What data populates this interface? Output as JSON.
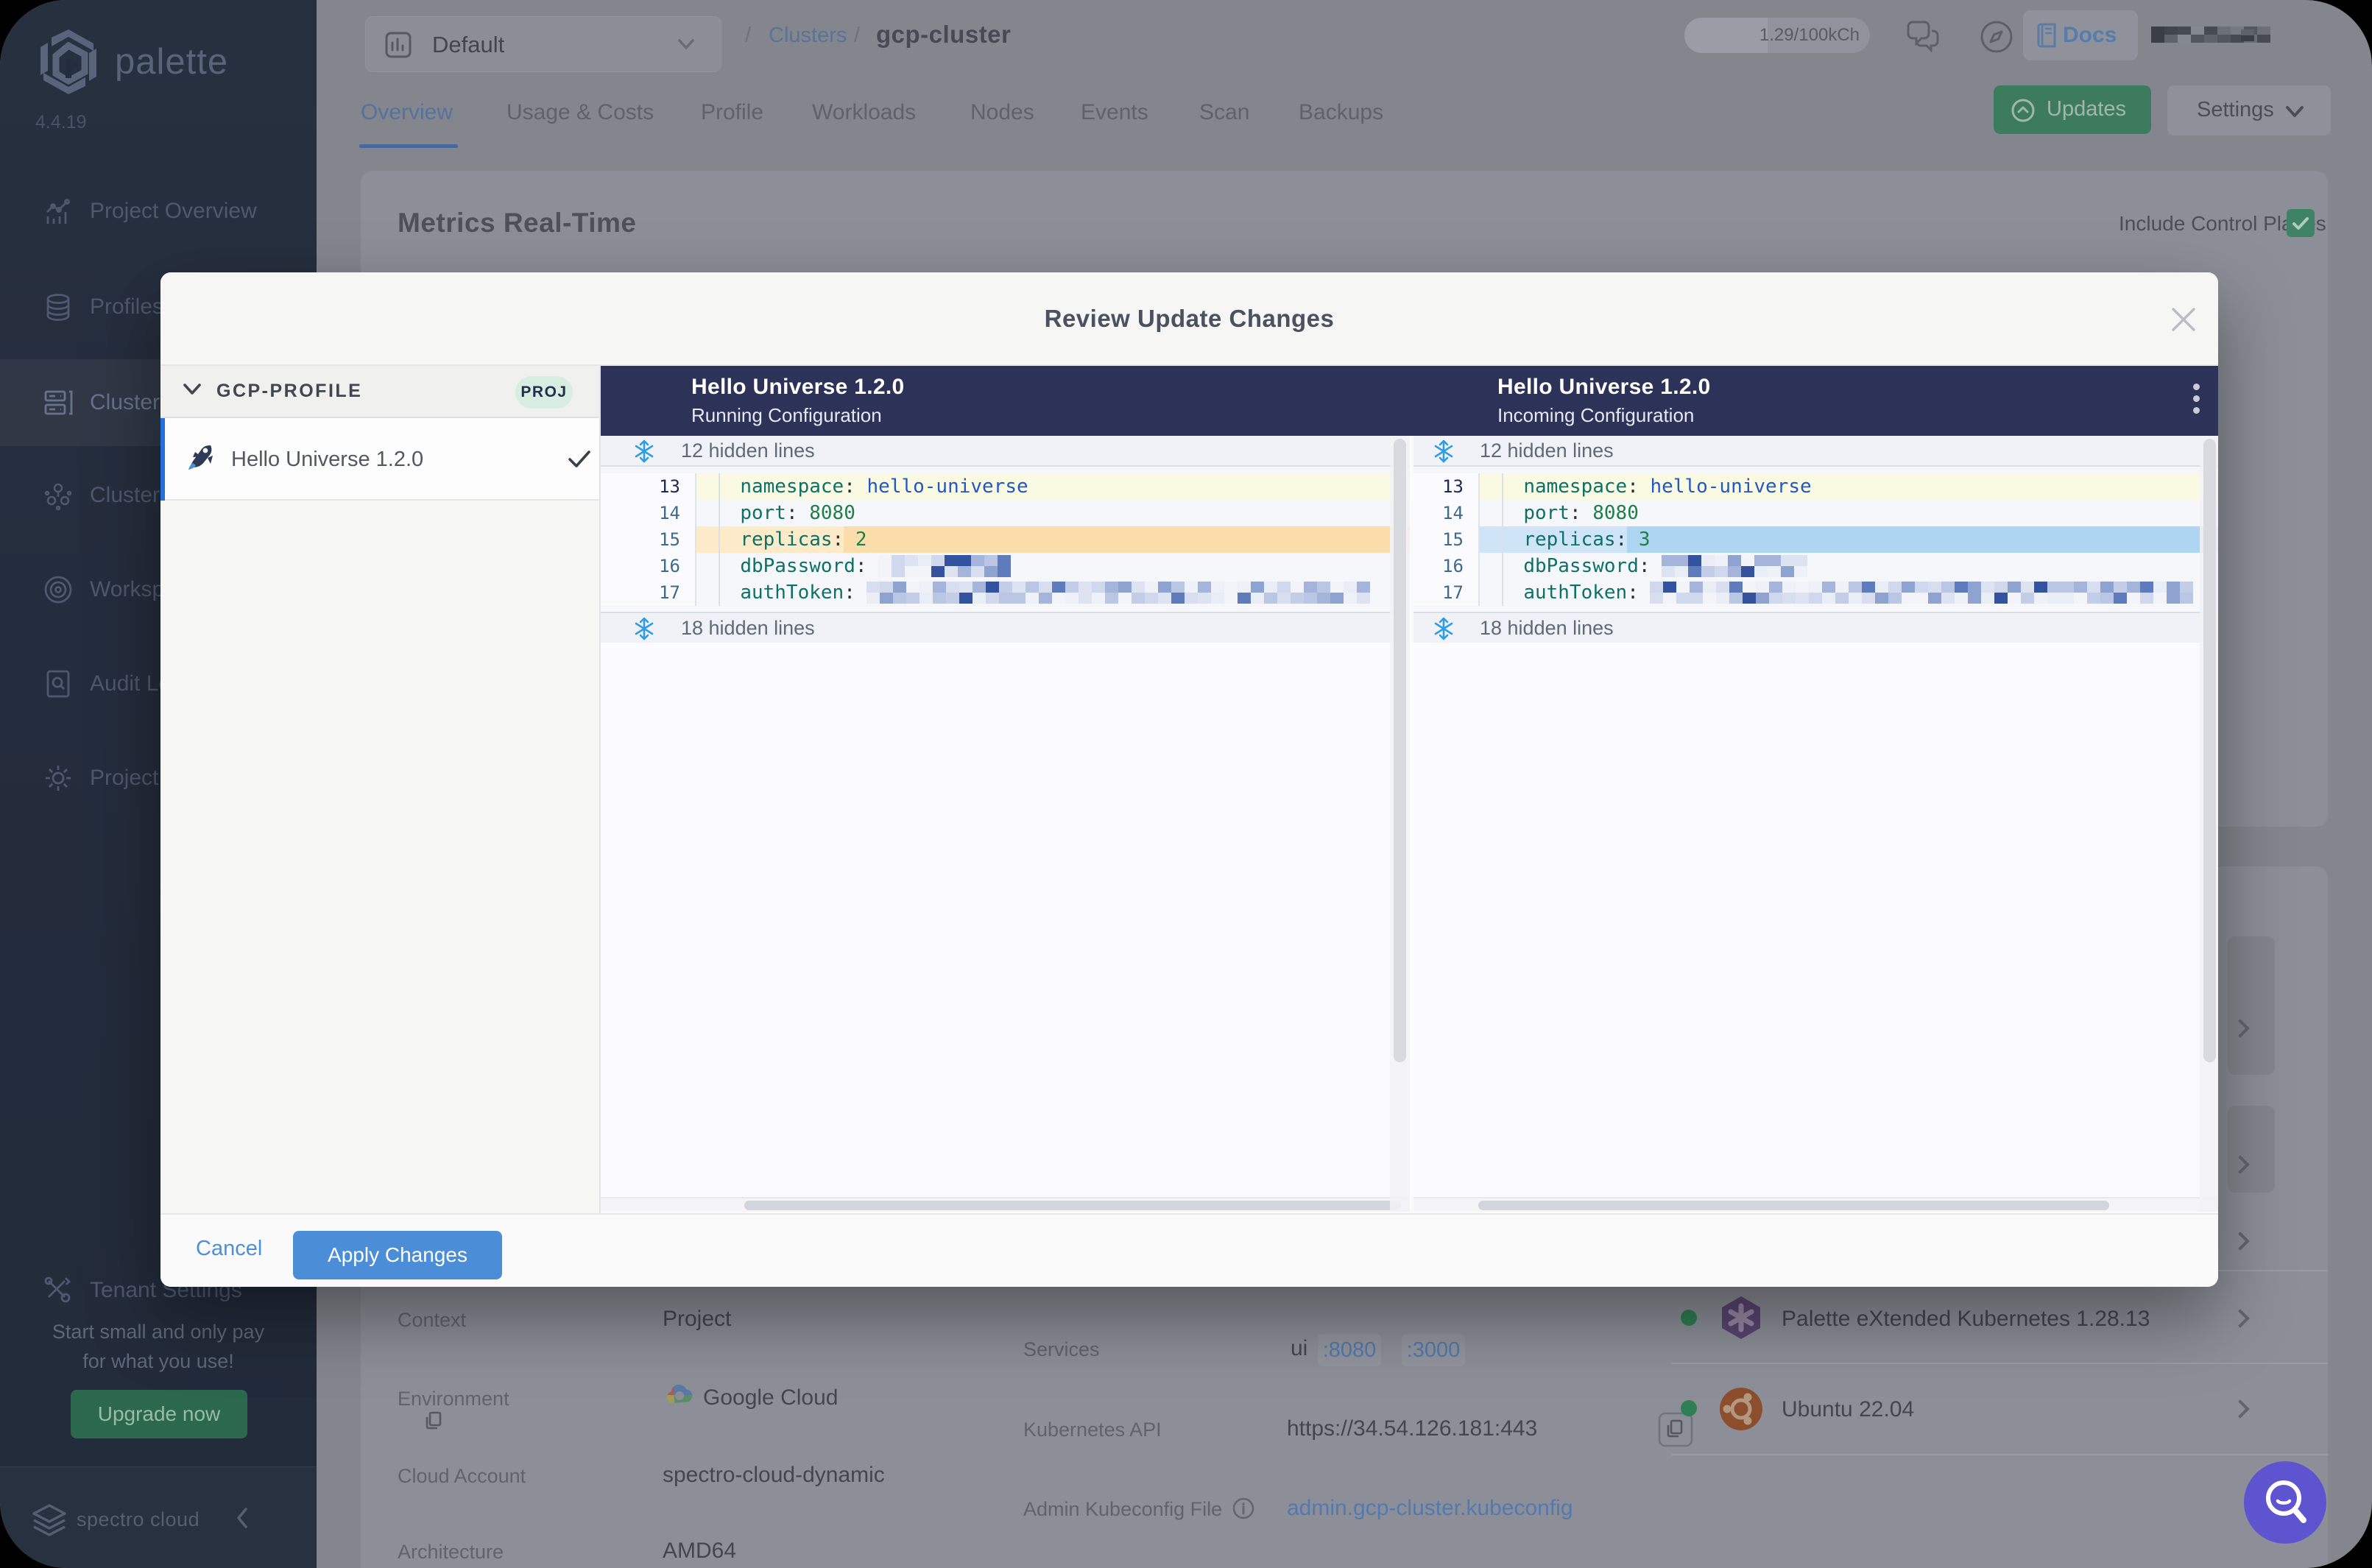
{
  "app": {
    "name": "palette",
    "version": "4.4.19",
    "brand": "spectro cloud"
  },
  "sidebar": {
    "items": [
      {
        "label": "Project Overview",
        "icon": "chart-icon"
      },
      {
        "label": "Profiles",
        "icon": "layers-icon"
      },
      {
        "label": "Clusters",
        "icon": "servers-icon",
        "active": true
      },
      {
        "label": "Cluster Groups",
        "icon": "nodes-icon"
      },
      {
        "label": "Workspaces",
        "icon": "target-icon"
      },
      {
        "label": "Audit Logs",
        "icon": "doc-search-icon"
      },
      {
        "label": "Project Settings",
        "icon": "gear-icon"
      },
      {
        "label": "Tenant Settings",
        "icon": "tools-icon"
      }
    ],
    "promo": {
      "line1": "Start small and only pay",
      "line2": "for what you use!",
      "button": "Upgrade now"
    }
  },
  "header": {
    "project_selector": "Default",
    "breadcrumb": {
      "sep1": "/",
      "link": "Clusters",
      "sep2": "/",
      "current": "gcp-cluster"
    },
    "usage": "1.29/100kCh",
    "docs": "Docs"
  },
  "toolbar": {
    "updates": "Updates",
    "settings": "Settings"
  },
  "tabs": {
    "items": [
      "Overview",
      "Usage & Costs",
      "Profile",
      "Workloads",
      "Nodes",
      "Events",
      "Scan",
      "Backups"
    ],
    "active": "Overview"
  },
  "metrics": {
    "title": "Metrics Real-Time",
    "checkbox_label": "Include Control Planes",
    "checked": true
  },
  "details": {
    "rows_left": [
      {
        "label": "Context",
        "value": "Project"
      },
      {
        "label": "Environment",
        "value": "Google Cloud"
      },
      {
        "label": "Cloud Account",
        "value": "spectro-cloud-dynamic"
      },
      {
        "label": "Architecture",
        "value": "AMD64"
      }
    ],
    "rows_mid": [
      {
        "label": "Services",
        "value": "ui",
        "ports": [
          ":8080",
          ":3000"
        ]
      },
      {
        "label": "Kubernetes API",
        "value": "https://34.54.126.181:443"
      },
      {
        "label": "Admin Kubeconfig File",
        "value": "admin.gcp-cluster.kubeconfig"
      }
    ],
    "packs": [
      {
        "name": "Palette eXtended Kubernetes 1.28.13",
        "status": "healthy",
        "icon": "pxk-hexagon-icon"
      },
      {
        "name": "Ubuntu 22.04",
        "status": "healthy",
        "icon": "ubuntu-icon"
      }
    ]
  },
  "modal": {
    "title": "Review Update Changes",
    "profile": {
      "name": "GCP-PROFILE",
      "scope": "PROJ",
      "pack": "Hello Universe 1.2.0"
    },
    "pane_left": {
      "title": "Hello Universe 1.2.0",
      "subtitle": "Running Configuration"
    },
    "pane_right": {
      "title": "Hello Universe 1.2.0",
      "subtitle": "Incoming Configuration"
    },
    "hidden_top": "12 hidden lines",
    "hidden_bottom": "18 hidden lines",
    "lines": [
      {
        "num": "13",
        "indent": "  ",
        "key": "namespace",
        "colon": ":",
        "sp": " ",
        "left": "hello-universe",
        "right": "hello-universe",
        "kind": "string",
        "row": "context"
      },
      {
        "num": "14",
        "indent": "  ",
        "key": "port",
        "colon": ":",
        "sp": " ",
        "left": "8080",
        "right": "8080",
        "kind": "number",
        "row": "normal"
      },
      {
        "num": "15",
        "indent": "  ",
        "key": "replicas",
        "colon": ":",
        "sp": " ",
        "left": "2",
        "right": "3",
        "kind": "number",
        "row": "changed"
      },
      {
        "num": "16",
        "indent": "  ",
        "key": "dbPassword",
        "colon": ":",
        "sp": " ",
        "left": "",
        "right": "",
        "kind": "redacted",
        "row": "normal"
      },
      {
        "num": "17",
        "indent": "  ",
        "key": "authToken",
        "colon": ":",
        "sp": " ",
        "left": "",
        "right": "",
        "kind": "redacted",
        "row": "normal"
      }
    ],
    "footer": {
      "cancel": "Cancel",
      "apply": "Apply Changes"
    }
  },
  "colors": {
    "modal_header_bar": "#2c3259",
    "diff_deleted_line": "#fdeac9",
    "diff_deleted_chunk": "#fbdcab",
    "diff_inserted_line": "#cfe4f7",
    "diff_inserted_chunk": "#aed5f2",
    "diff_context_line": "#fafae3",
    "accent_blue": "#4b8dd7",
    "accent_green": "#3c8162",
    "fab_purple": "#5f54d0",
    "sidebar_bg": "#242d3d"
  }
}
